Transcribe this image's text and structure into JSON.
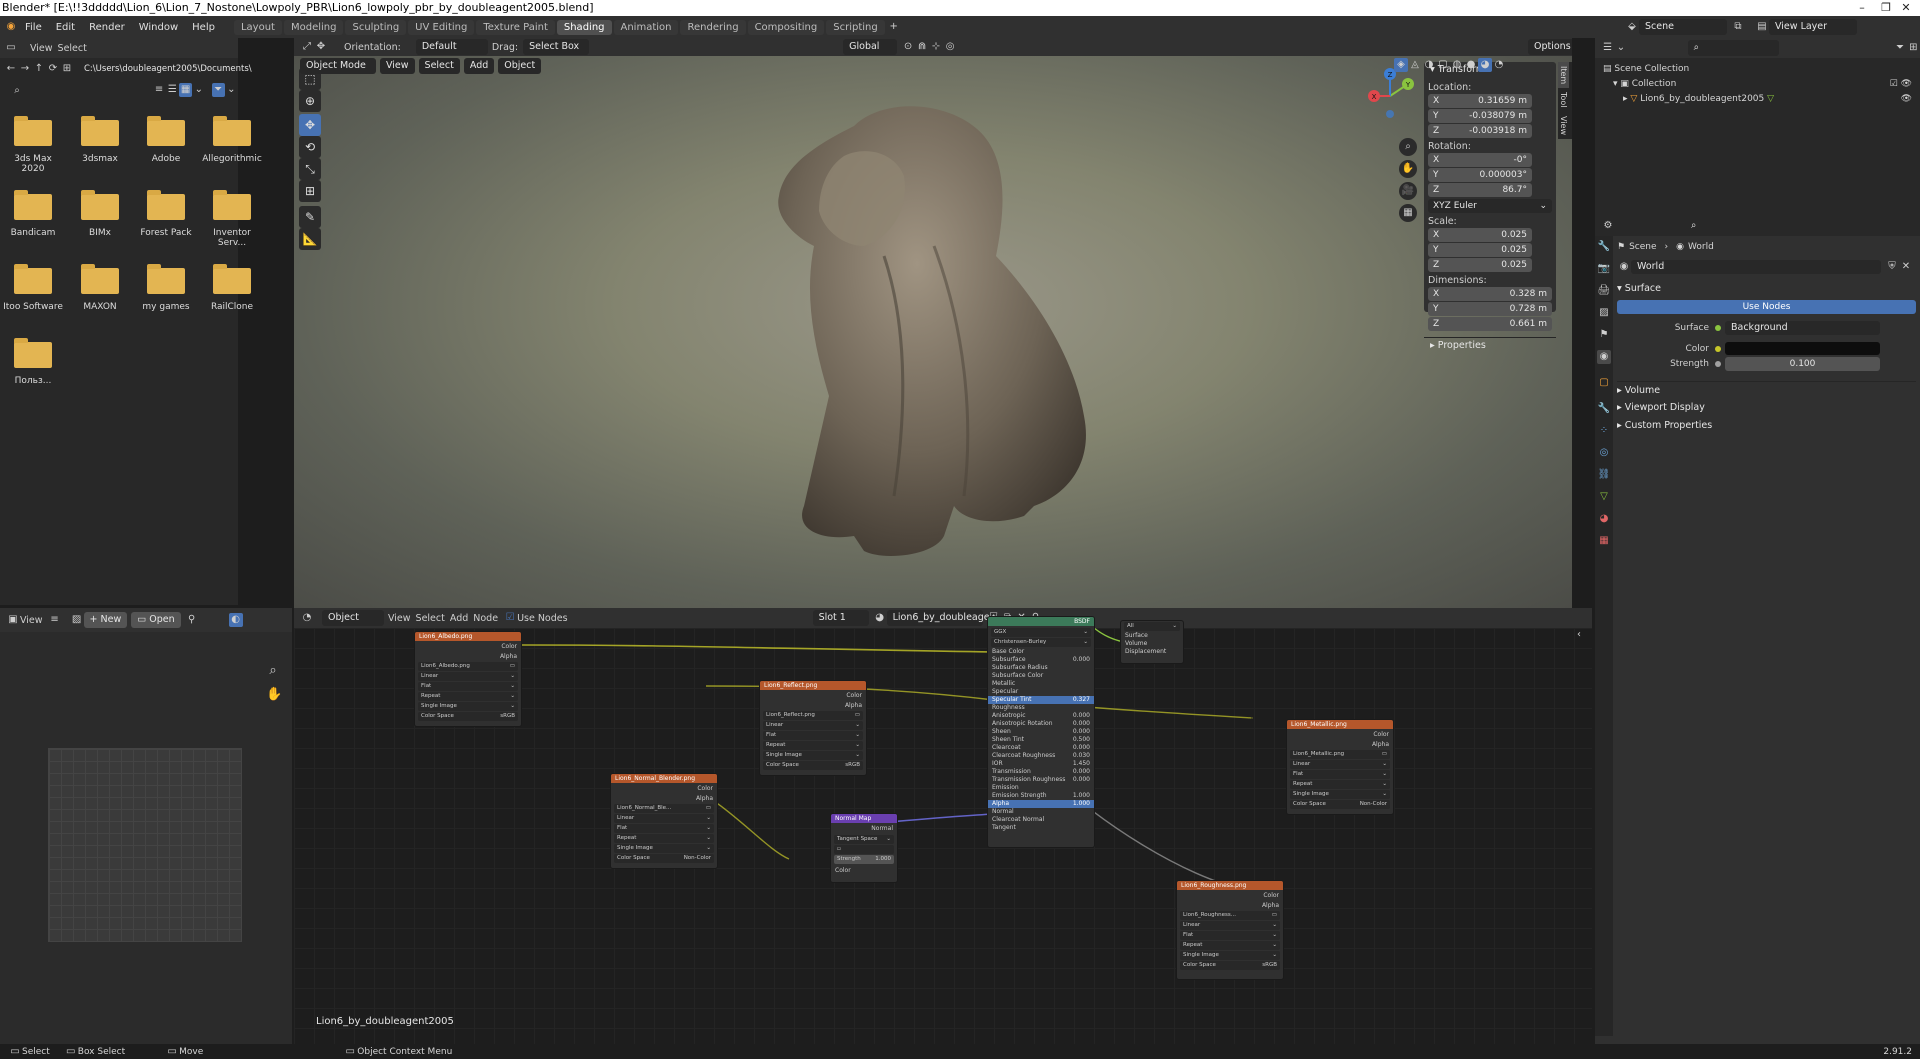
{
  "window": {
    "title": "Blender* [E:\\!!3ddddd\\Lion_6\\Lion_7_Nostone\\Lowpoly_PBR\\Lion6_lowpoly_pbr_by_doubleagent2005.blend]"
  },
  "menu": [
    "File",
    "Edit",
    "Render",
    "Window",
    "Help"
  ],
  "workspaces": [
    "Layout",
    "Modeling",
    "Sculpting",
    "UV Editing",
    "Texture Paint",
    "Shading",
    "Animation",
    "Rendering",
    "Compositing",
    "Scripting"
  ],
  "active_workspace": "Shading",
  "scene_selector": {
    "scene": "Scene",
    "view_layer": "View Layer"
  },
  "file_browser": {
    "menu": [
      "View",
      "Select"
    ],
    "path": "C:\\Users\\doubleagent2005\\Documents\\",
    "folders": [
      "3ds Max 2020",
      "3dsmax",
      "Adobe",
      "Allegorithmic",
      "Bandicam",
      "BIMx",
      "Forest Pack",
      "Inventor Serv...",
      "Itoo Software",
      "MAXON",
      "my games",
      "RailClone",
      "Польз..."
    ]
  },
  "viewport": {
    "mode": "Object Mode",
    "menus": [
      "View",
      "Select",
      "Add",
      "Object"
    ],
    "orientation_label": "Orientation:",
    "orientation_value": "Default",
    "drag_label": "Drag:",
    "drag_value": "Select Box",
    "transform_space": "Global",
    "options": "Options",
    "gizmo": {
      "x": "X",
      "y": "Y",
      "z": "Z"
    }
  },
  "sidebar": {
    "tabs": [
      "Item",
      "Tool",
      "View"
    ],
    "transform_title": "Transform",
    "location_label": "Location:",
    "location": {
      "x": "0.31659 m",
      "y": "-0.038079 m",
      "z": "-0.003918 m"
    },
    "rotation_label": "Rotation:",
    "rotation": {
      "x": "-0°",
      "y": "0.000003°",
      "z": "86.7°"
    },
    "rotation_mode": "XYZ Euler",
    "scale_label": "Scale:",
    "scale": {
      "x": "0.025",
      "y": "0.025",
      "z": "0.025"
    },
    "dimensions_label": "Dimensions:",
    "dimensions": {
      "x": "0.328 m",
      "y": "0.728 m",
      "z": "0.661 m"
    },
    "properties_title": "Properties"
  },
  "outliner": {
    "root": "Scene Collection",
    "collection": "Collection",
    "object": "Lion6_by_doubleagent2005"
  },
  "properties": {
    "breadcrumb": [
      "Scene",
      "World"
    ],
    "world_name": "World",
    "surface_section": "Surface",
    "use_nodes": "Use Nodes",
    "surface_label": "Surface",
    "surface_value": "Background",
    "color_label": "Color",
    "strength_label": "Strength",
    "strength_value": "0.100",
    "sections": [
      "Volume",
      "Viewport Display",
      "Custom Properties"
    ]
  },
  "image_editor": {
    "view": "View",
    "new": "New",
    "open": "Open"
  },
  "node_editor": {
    "object_type": "Object",
    "menus": [
      "View",
      "Select",
      "Add",
      "Node"
    ],
    "use_nodes": "Use Nodes",
    "slot": "Slot 1",
    "material": "Lion6_by_doubleage...",
    "object_label": "Lion6_by_doubleagent2005",
    "nodes": {
      "albedo": {
        "title": "Lion6_Albedo.png",
        "file": "Lion6_Albedo.png",
        "opts": [
          "Linear",
          "Flat",
          "Repeat",
          "Single Image"
        ],
        "colorspace": "sRGB"
      },
      "reflect": {
        "title": "Lion6_Reflect.png",
        "file": "Lion6_Reflect.png",
        "opts": [
          "Linear",
          "Flat",
          "Repeat",
          "Single Image"
        ],
        "colorspace": "sRGB"
      },
      "normal": {
        "title": "Lion6_Normal_Blender.png",
        "file": "Lion6_Normal_Ble...",
        "opts": [
          "Linear",
          "Flat",
          "Repeat",
          "Single Image"
        ],
        "colorspace": "Non-Color"
      },
      "normalmap": {
        "title": "Normal Map",
        "space": "Tangent Space",
        "strength_label": "Strength",
        "strength": "1.000"
      },
      "metallic": {
        "title": "Lion6_Metallic.png",
        "file": "Lion6_Metallic.png",
        "opts": [
          "Linear",
          "Flat",
          "Repeat",
          "Single Image"
        ],
        "colorspace": "Non-Color"
      },
      "roughness": {
        "title": "Lion6_Roughness.png",
        "file": "Lion6_Roughness...",
        "opts": [
          "Linear",
          "Flat",
          "Repeat",
          "Single Image"
        ],
        "colorspace": "sRGB"
      },
      "bsdf": {
        "dist": "GGX",
        "sss": "Christensen-Burley",
        "rows": [
          [
            "Subsurface",
            "0.000"
          ],
          [
            "Subsurface Radius",
            ""
          ],
          [
            "Subsurface Color",
            ""
          ],
          [
            "Metallic",
            ""
          ],
          [
            "Specular",
            ""
          ],
          [
            "Specular Tint",
            "0.327"
          ],
          [
            "Roughness",
            ""
          ],
          [
            "Anisotropic",
            "0.000"
          ],
          [
            "Anisotropic Rotation",
            "0.000"
          ],
          [
            "Sheen",
            "0.000"
          ],
          [
            "Sheen Tint",
            "0.500"
          ],
          [
            "Clearcoat",
            "0.000"
          ],
          [
            "Clearcoat Roughness",
            "0.030"
          ],
          [
            "IOR",
            "1.450"
          ],
          [
            "Transmission",
            "0.000"
          ],
          [
            "Transmission Roughness",
            "0.000"
          ],
          [
            "Emission",
            ""
          ],
          [
            "Emission Strength",
            "1.000"
          ],
          [
            "Alpha",
            "1.000"
          ],
          [
            "Normal",
            ""
          ],
          [
            "Clearcoat Normal",
            ""
          ],
          [
            "Tangent",
            ""
          ]
        ]
      },
      "output": {
        "target": "All",
        "rows": [
          "Surface",
          "Volume",
          "Displacement"
        ]
      }
    }
  },
  "statusbar": {
    "select": "Select",
    "box_select": "Box Select",
    "move": "Move",
    "context_menu": "Object Context Menu",
    "version": "2.91.2"
  },
  "colors": {
    "accent": "#4772b3",
    "image_node": "#b5572b",
    "vector_node": "#6a3fb0",
    "socket_yellow": "#c7c729",
    "socket_gray": "#a1a1a1",
    "socket_purple": "#6363c7"
  }
}
